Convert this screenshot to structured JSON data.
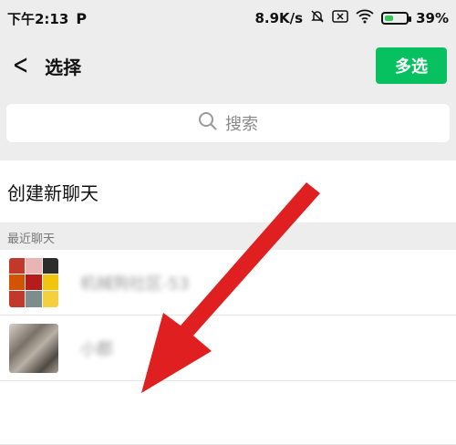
{
  "status_bar": {
    "time": "下午2:13",
    "p_icon": "P",
    "network_speed": "8.9K/s",
    "battery_percent": "39%",
    "icons": [
      "bell-off-icon",
      "sim-x-icon",
      "wifi-icon",
      "battery-charging-icon"
    ]
  },
  "header": {
    "back_icon": "chevron-left-icon",
    "title": "选择",
    "multi_select_label": "多选"
  },
  "search": {
    "placeholder": "搜索",
    "icon": "search-icon"
  },
  "create_new_chat": "创建新聊天",
  "recent_section": {
    "label": "最近聊天",
    "items": [
      {
        "name": "机械狗社区-53"
      },
      {
        "name": "小郡"
      }
    ]
  },
  "colors": {
    "accent_green": "#07c160",
    "annotation_red": "#e02020",
    "background": "#ededed"
  },
  "overlay": {
    "icon": "red-annotation-arrow"
  }
}
